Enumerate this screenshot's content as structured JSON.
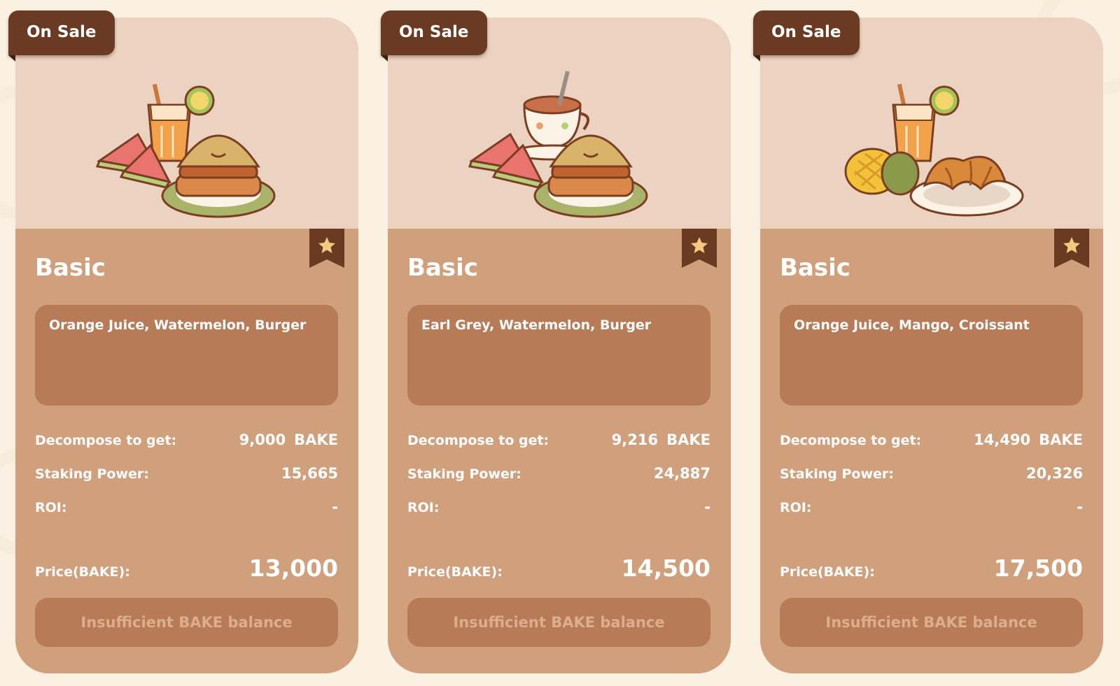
{
  "cards": [
    {
      "badge": "On Sale",
      "tier": "Basic",
      "items": "Orange Juice, Watermelon, Burger",
      "decompose_label": "Decompose to get:",
      "decompose_value": "9,000",
      "decompose_token": "BAKE",
      "staking_label": "Staking Power:",
      "staking_value": "15,665",
      "roi_label": "ROI:",
      "roi_value": "-",
      "price_label": "Price(BAKE):",
      "price_value": "13,000",
      "button_label": "Insufficient BAKE balance",
      "art": [
        "orange-juice-icon",
        "watermelon-icon",
        "burger-icon"
      ]
    },
    {
      "badge": "On Sale",
      "tier": "Basic",
      "items": "Earl Grey, Watermelon, Burger",
      "decompose_label": "Decompose to get:",
      "decompose_value": "9,216",
      "decompose_token": "BAKE",
      "staking_label": "Staking Power:",
      "staking_value": "24,887",
      "roi_label": "ROI:",
      "roi_value": "-",
      "price_label": "Price(BAKE):",
      "price_value": "14,500",
      "button_label": "Insufficient BAKE balance",
      "art": [
        "earl-grey-icon",
        "watermelon-icon",
        "burger-icon"
      ]
    },
    {
      "badge": "On Sale",
      "tier": "Basic",
      "items": "Orange Juice, Mango, Croissant",
      "decompose_label": "Decompose to get:",
      "decompose_value": "14,490",
      "decompose_token": "BAKE",
      "staking_label": "Staking Power:",
      "staking_value": "20,326",
      "roi_label": "ROI:",
      "roi_value": "-",
      "price_label": "Price(BAKE):",
      "price_value": "17,500",
      "button_label": "Insufficient BAKE balance",
      "art": [
        "orange-juice-icon",
        "mango-icon",
        "croissant-icon"
      ]
    }
  ],
  "colors": {
    "background": "#fbf1e2",
    "card_body": "#d09f7c",
    "card_top": "#ecd3c1",
    "panel": "#b87b58",
    "badge": "#6a3a22",
    "star": "#f6c981",
    "disabled_text": "#ddae8d"
  },
  "icons": [
    "star-icon",
    "bookmark-icon"
  ]
}
